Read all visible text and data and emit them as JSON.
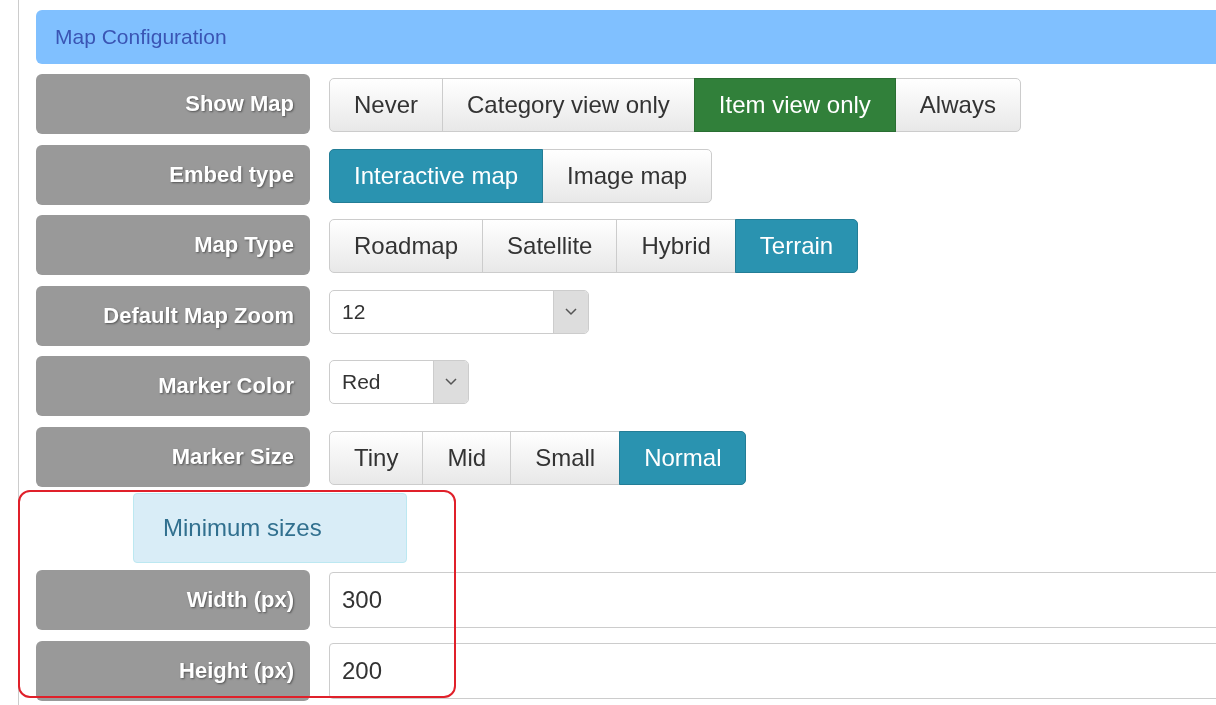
{
  "panel": {
    "title": "Map Configuration"
  },
  "rows": [
    {
      "kind": "buttons",
      "label": "Show Map",
      "options": [
        {
          "label": "Never",
          "selected": false
        },
        {
          "label": "Category view only",
          "selected": false
        },
        {
          "label": "Item view only",
          "selected": true
        },
        {
          "label": "Always",
          "selected": false
        }
      ]
    },
    {
      "kind": "buttons",
      "label": "Embed type",
      "options": [
        {
          "label": "Interactive map",
          "selected": true
        },
        {
          "label": "Image map",
          "selected": false
        }
      ]
    },
    {
      "kind": "buttons",
      "label": "Map Type",
      "options": [
        {
          "label": "Roadmap",
          "selected": false
        },
        {
          "label": "Satellite",
          "selected": false
        },
        {
          "label": "Hybrid",
          "selected": false
        },
        {
          "label": "Terrain",
          "selected": true
        }
      ]
    },
    {
      "kind": "select",
      "label": "Default Map Zoom",
      "value": "12"
    },
    {
      "kind": "select",
      "label": "Marker Color",
      "value": "Red"
    },
    {
      "kind": "buttons",
      "label": "Marker Size",
      "options": [
        {
          "label": "Tiny",
          "selected": false
        },
        {
          "label": "Mid",
          "selected": false
        },
        {
          "label": "Small",
          "selected": false
        },
        {
          "label": "Normal",
          "selected": true
        }
      ]
    },
    {
      "kind": "section",
      "label": "Minimum sizes"
    },
    {
      "kind": "text",
      "label": "Width (px)",
      "value": "300"
    },
    {
      "kind": "text",
      "label": "Height (px)",
      "value": "200"
    }
  ]
}
